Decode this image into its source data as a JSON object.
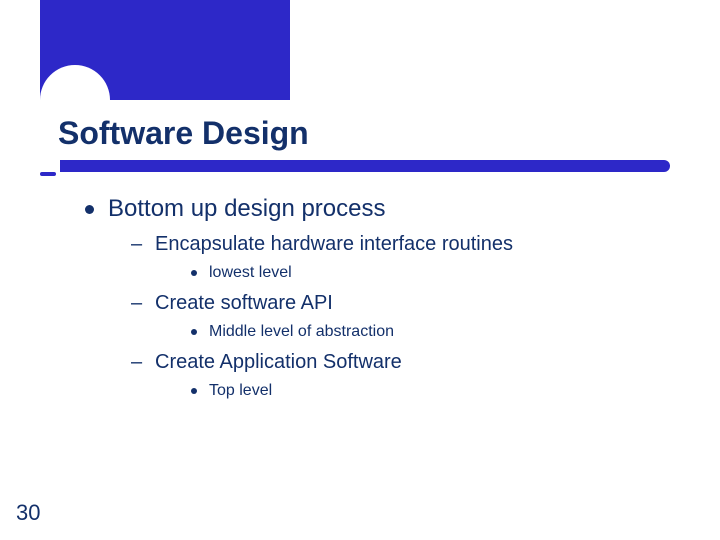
{
  "title": "Software Design",
  "bullet": {
    "text": "Bottom up design process",
    "subs": [
      {
        "text": "Encapsulate hardware interface routines",
        "note": "lowest level"
      },
      {
        "text": "Create software API",
        "note": "Middle level of abstraction"
      },
      {
        "text": "Create Application Software",
        "note": "Top level"
      }
    ]
  },
  "page_number": "30"
}
